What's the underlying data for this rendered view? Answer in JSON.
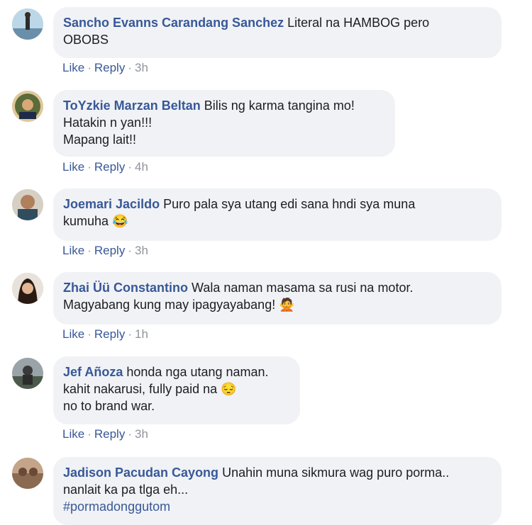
{
  "comments": [
    {
      "author": "Sancho Evanns Carandang Sanchez",
      "lines": [
        "Literal na HAMBOG pero",
        "OBOBS"
      ],
      "like": "Like",
      "reply": "Reply",
      "time": "3h"
    },
    {
      "author": "ToYzkie Marzan Beltan",
      "lines": [
        "Bilis ng karma tangina mo!",
        "Hatakin n yan!!!",
        "Mapang lait!!"
      ],
      "like": "Like",
      "reply": "Reply",
      "time": "4h"
    },
    {
      "author": "Joemari Jacildo",
      "lines": [
        "Puro pala sya utang edi sana hndi sya muna",
        "kumuha"
      ],
      "emoji": "😂",
      "like": "Like",
      "reply": "Reply",
      "time": "3h"
    },
    {
      "author": "Zhai Üü Constantino",
      "lines": [
        "Wala naman masama sa rusi na motor.",
        "Magyabang kung may ipagyayabang!"
      ],
      "emoji": "🙅",
      "like": "Like",
      "reply": "Reply",
      "time": "1h"
    },
    {
      "author": "Jef Añoza",
      "lines": [
        "honda nga utang naman.",
        "kahit nakarusi, fully paid na",
        "no to brand war."
      ],
      "emoji": "😔",
      "like": "Like",
      "reply": "Reply",
      "time": "3h"
    },
    {
      "author": "Jadison Pacudan Cayong",
      "lines": [
        "Unahin muna sikmura wag puro porma..",
        "nanlait ka pa tlga eh...",
        "#pormadonggutom"
      ]
    }
  ],
  "action_separator": "·"
}
